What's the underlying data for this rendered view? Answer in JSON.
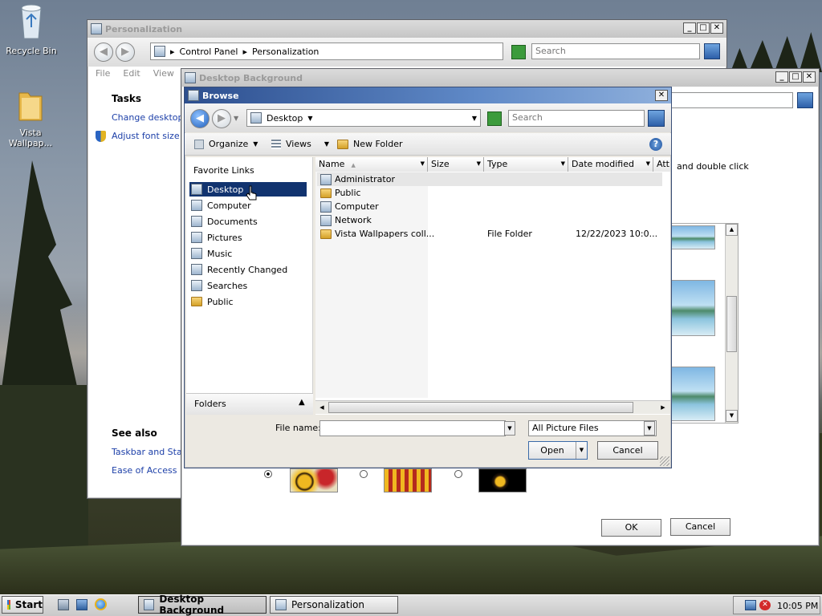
{
  "desktop": {
    "icons": [
      {
        "label": "Recycle Bin",
        "icon": "recycle-bin-icon"
      },
      {
        "label_line1": "Vista",
        "label_line2": "Wallpap...",
        "icon": "folder-icon"
      }
    ]
  },
  "personalization": {
    "title": "Personalization",
    "address": [
      "Control Panel",
      "Personalization"
    ],
    "search_placeholder": "Search",
    "menu": [
      "File",
      "Edit",
      "View"
    ],
    "tasks_title": "Tasks",
    "tasks": [
      "Change desktop ic",
      "Adjust font size (D"
    ],
    "see_also_title": "See also",
    "see_also": [
      "Taskbar and Start",
      "Ease of Access"
    ]
  },
  "desktop_background": {
    "title": "Desktop Background",
    "hint": "and double click",
    "ok": "OK",
    "cancel": "Cancel"
  },
  "browse": {
    "title": "Browse",
    "location": "Desktop",
    "search_placeholder": "Search",
    "toolbar": {
      "organize": "Organize",
      "views": "Views",
      "new_folder": "New Folder"
    },
    "favorite_links_title": "Favorite Links",
    "favorite_links": [
      {
        "label": "Desktop",
        "selected": true
      },
      {
        "label": "Computer"
      },
      {
        "label": "Documents"
      },
      {
        "label": "Pictures"
      },
      {
        "label": "Music"
      },
      {
        "label": "Recently Changed"
      },
      {
        "label": "Searches"
      },
      {
        "label": "Public"
      }
    ],
    "folders_label": "Folders",
    "columns": [
      "Name",
      "Size",
      "Type",
      "Date modified",
      "Attr"
    ],
    "files": [
      {
        "name": "Administrator",
        "type": "",
        "date": ""
      },
      {
        "name": "Public",
        "type": "",
        "date": ""
      },
      {
        "name": "Computer",
        "type": "",
        "date": ""
      },
      {
        "name": "Network",
        "type": "",
        "date": ""
      },
      {
        "name": "Vista Wallpapers coll...",
        "type": "File Folder",
        "date": "12/22/2023 10:0..."
      }
    ],
    "file_name_label": "File name:",
    "file_name_value": "",
    "filter": "All Picture Files",
    "open": "Open",
    "cancel": "Cancel"
  },
  "taskbar": {
    "start": "Start",
    "tasks": [
      "Desktop Background",
      "Personalization"
    ],
    "clock": "10:05 PM"
  }
}
